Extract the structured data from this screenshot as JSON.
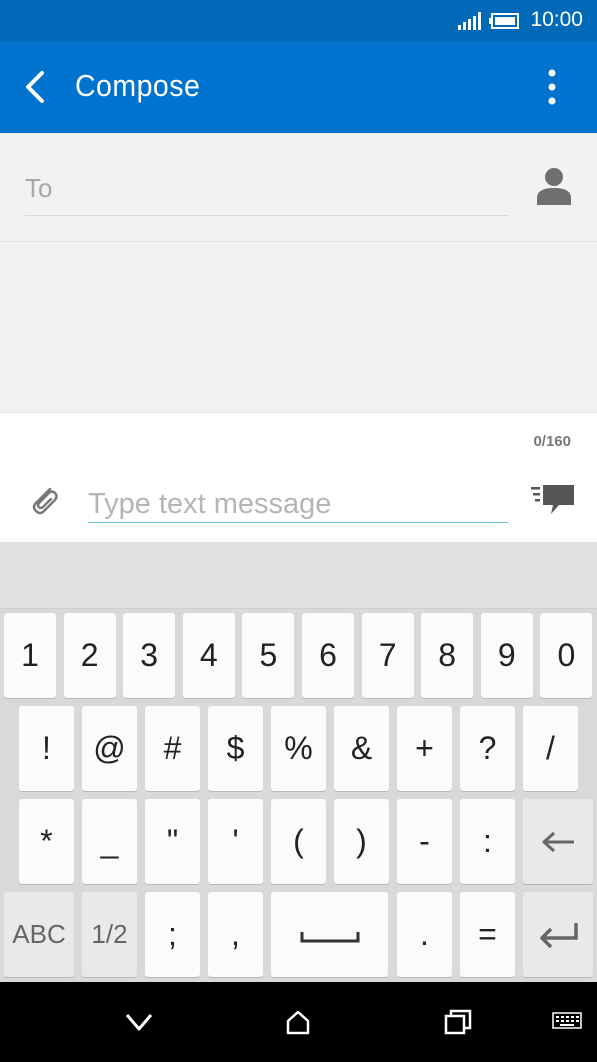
{
  "status_bar": {
    "time": "10:00",
    "signal_icon": "signal-icon",
    "battery_icon": "battery-icon"
  },
  "app_bar": {
    "title": "Compose",
    "back_icon": "back-arrow-icon",
    "menu_icon": "more-vert-icon"
  },
  "to_field": {
    "label": "To",
    "contact_icon": "person-icon"
  },
  "compose": {
    "char_count": "0/160",
    "placeholder": "Type text message",
    "value": "",
    "attach_icon": "paperclip-icon",
    "send_icon": "send-message-icon"
  },
  "keyboard": {
    "row1": [
      "1",
      "2",
      "3",
      "4",
      "5",
      "6",
      "7",
      "8",
      "9",
      "0"
    ],
    "row2": [
      "!",
      "@",
      "#",
      "$",
      "%",
      "&",
      "+",
      "?",
      "/"
    ],
    "row3": [
      "*",
      "_",
      "\"",
      "'",
      "(",
      ")",
      "-",
      ":"
    ],
    "row4": {
      "abc": "ABC",
      "page": "1/2",
      "semicolon": ";",
      "comma": ",",
      "period": ".",
      "equals": "="
    }
  },
  "nav_bar": {
    "back": "chevron-down-icon",
    "home": "home-icon",
    "recents": "recents-icon",
    "keyboard": "keyboard-icon"
  },
  "colors": {
    "status_bar": "#0069b8",
    "app_bar": "#0073cf",
    "accent_underline": "#66c8d6"
  }
}
